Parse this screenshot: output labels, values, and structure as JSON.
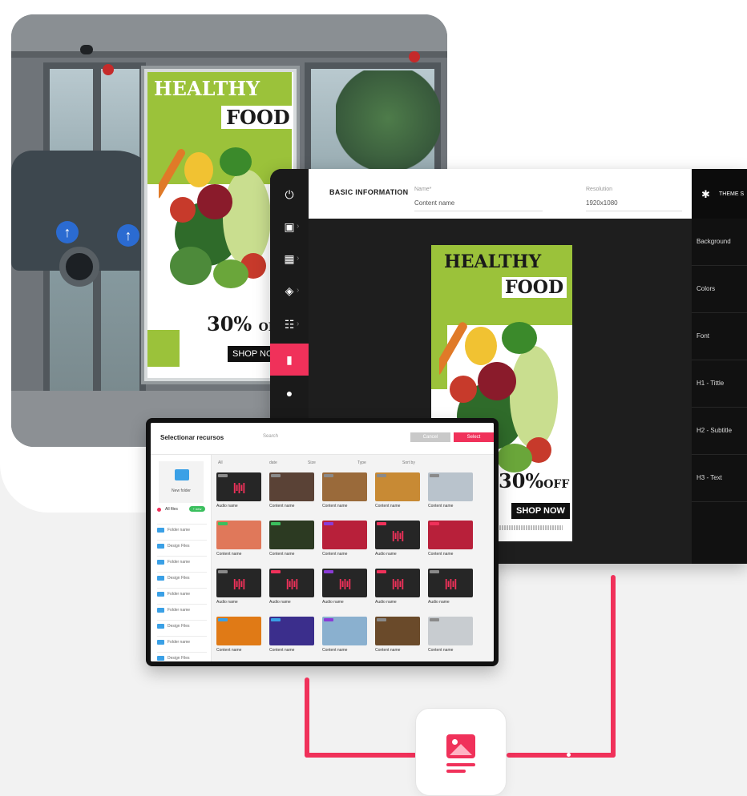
{
  "poster": {
    "title_line1": "HEALTHY",
    "title_line2": "FOOD",
    "discount": "30%",
    "discount_suffix": "OFF",
    "cta": "SHOP NOW"
  },
  "editor": {
    "section_title": "BASIC INFORMATION",
    "name_label": "Name*",
    "name_value": "Content name",
    "resolution_label": "Resolution",
    "resolution_value": "1920x1080",
    "theme_title": "THEME S",
    "theme_items": [
      "Background",
      "Colors",
      "Font",
      "H1 - Tittle",
      "H2 - Subtitle",
      "H3 - Text"
    ],
    "sidebar_icons": [
      "power-icon",
      "screen-icon",
      "grid-icon",
      "tag-icon",
      "sliders-icon",
      "document-icon",
      "palette-icon"
    ]
  },
  "resources": {
    "title": "Selectionar recursos",
    "search_placeholder": "Search",
    "cancel_label": "Cancel",
    "select_label": "Select",
    "new_folder_label": "New folder",
    "all_files_label": "All files",
    "all_files_badge": "+ new",
    "folders": [
      "Folder name",
      "Design Files",
      "Folder name",
      "Design Files",
      "Folder name",
      "Folder name",
      "Design Files",
      "Folder name",
      "Design Files"
    ],
    "filters": [
      "All",
      "date",
      "Size",
      "Type",
      "Sort by"
    ],
    "grid": [
      {
        "name": "Audio name",
        "kind": "audio",
        "tag": "#8a8a8a",
        "color": "#262626"
      },
      {
        "name": "Content name",
        "kind": "image",
        "tag": "#8a8a8a",
        "color": "#5a4236"
      },
      {
        "name": "Content name",
        "kind": "image",
        "tag": "#8a8a8a",
        "color": "#9a6a3a"
      },
      {
        "name": "Content name",
        "kind": "image",
        "tag": "#8a8a8a",
        "color": "#c88a34"
      },
      {
        "name": "Content name",
        "kind": "image",
        "tag": "#8a8a8a",
        "color": "#b9c3cc"
      },
      {
        "name": "Content name",
        "kind": "image",
        "tag": "#3bbf5e",
        "color": "#e0785a"
      },
      {
        "name": "Content name",
        "kind": "image",
        "tag": "#3bbf5e",
        "color": "#2c3a22"
      },
      {
        "name": "Content name",
        "kind": "image",
        "tag": "#8a3bd6",
        "color": "#b8203a"
      },
      {
        "name": "Audio name",
        "kind": "audio",
        "tag": "#f0315a",
        "color": "#262626"
      },
      {
        "name": "Content name",
        "kind": "image",
        "tag": "#f0315a",
        "color": "#b8203a"
      },
      {
        "name": "Audio name",
        "kind": "audio",
        "tag": "#8a8a8a",
        "color": "#262626"
      },
      {
        "name": "Audio name",
        "kind": "audio",
        "tag": "#f0315a",
        "color": "#262626"
      },
      {
        "name": "Audio name",
        "kind": "audio",
        "tag": "#8a3bd6",
        "color": "#262626"
      },
      {
        "name": "Audio name",
        "kind": "audio",
        "tag": "#f0315a",
        "color": "#262626"
      },
      {
        "name": "Audio name",
        "kind": "audio",
        "tag": "#8a8a8a",
        "color": "#262626"
      },
      {
        "name": "Content name",
        "kind": "image",
        "tag": "#3aa0e6",
        "color": "#e07a16"
      },
      {
        "name": "Content name",
        "kind": "image",
        "tag": "#3aa0e6",
        "color": "#3b2e8c"
      },
      {
        "name": "Content name",
        "kind": "image",
        "tag": "#8a3bd6",
        "color": "#8ab0cf"
      },
      {
        "name": "Content name",
        "kind": "image",
        "tag": "#8a8a8a",
        "color": "#6a4a2a"
      },
      {
        "name": "Content name",
        "kind": "image",
        "tag": "#8a8a8a",
        "color": "#c8ccd0"
      }
    ]
  },
  "colors": {
    "accent": "#f0315a",
    "poster_green": "#9bc23a",
    "editor_bg": "#1e1e1e"
  }
}
